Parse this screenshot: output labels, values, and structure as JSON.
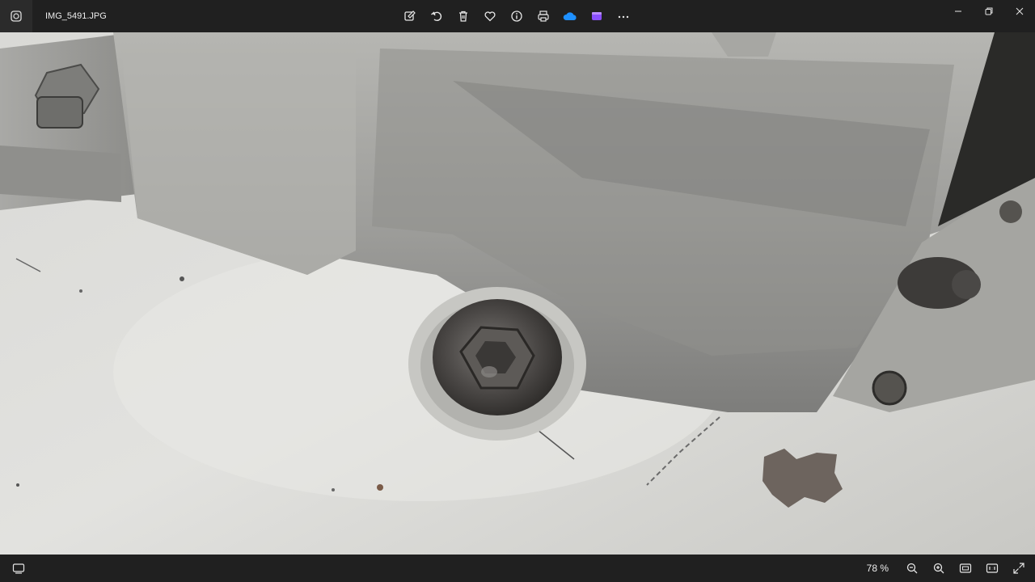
{
  "window": {
    "filename": "IMG_5491.JPG"
  },
  "toolbar": {
    "icons": [
      "edit-image-icon",
      "rotate-icon",
      "delete-icon",
      "favorite-heart-icon",
      "info-icon",
      "print-icon",
      "onedrive-cloud-icon",
      "clipchamp-video-icon",
      "more-options-icon"
    ]
  },
  "window_controls": [
    "minimize-icon",
    "restore-icon",
    "close-icon"
  ],
  "status": {
    "zoom": "78 %"
  },
  "colors": {
    "bar_bg": "#202020",
    "onedrive_blue": "#1e90ff",
    "clipchamp_purple": "#8a4fff"
  }
}
